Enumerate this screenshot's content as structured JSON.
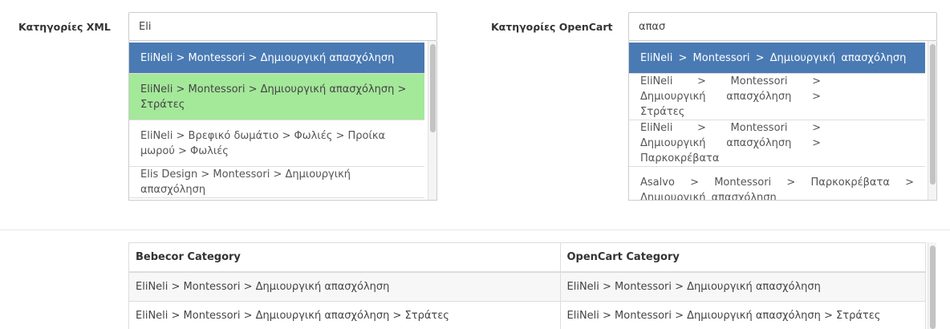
{
  "xml_filter": {
    "label": "Κατηγορίες XML",
    "value": "Eli",
    "items": [
      "EliNeli > Montessori > Δημιουργική απασχόληση",
      "EliNeli > Montessori > Δημιουργική απασχόληση > Στράτες",
      "EliNeli > Βρεφικό δωμάτιο > Φωλιές > Προίκα μωρού > Φωλιές",
      "Elis Design > Montessori > Δημιουργική απασχόληση"
    ]
  },
  "opencart_filter": {
    "label": "Κατηγορίες OpenCart",
    "value": "απασ",
    "items": [
      "EliNeli > Montessori > Δημιουργική απασχόληση",
      "EliNeli > Montessori > Δημιουργική απασχόληση > Στράτες",
      "EliNeli > Montessori > Δημιουργική απασχόληση > Παρκοκρέβατα",
      "Asalvo > Montessori > Παρκοκρέβατα > Δημιουργική απασχόληση"
    ]
  },
  "mapping_table": {
    "headers": [
      "Bebecor Category",
      "OpenCart Category"
    ],
    "rows": [
      [
        "EliNeli > Montessori > Δημιουργική απασχόληση",
        "EliNeli  >  Montessori > Δημιουργική απασχόληση"
      ],
      [
        "EliNeli > Montessori > Δημιουργική απασχόληση > Στράτες",
        "EliNeli  >  Montessori  >  Δημιουργική απασχόληση > Στράτες"
      ]
    ]
  },
  "colors": {
    "active": "#4a7ab3",
    "highlight": "#a4e89a"
  }
}
